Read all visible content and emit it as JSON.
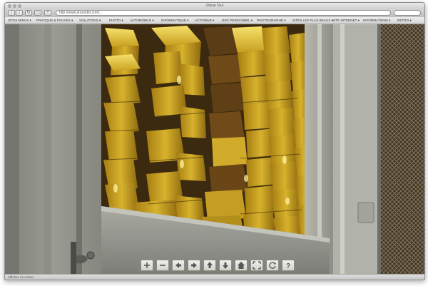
{
  "window": {
    "title": "Virtual Tour"
  },
  "toolbar": {
    "back_icon": "back-arrow-icon",
    "forward_icon": "forward-arrow-icon",
    "reload_icon": "reload-icon",
    "add_icon": "add-tab-icon",
    "url": "http://www.arounder.com/..."
  },
  "menubar": {
    "items": [
      "SITES MINUS ▾",
      "PRATIQUE & POUVES ▾",
      "SOLUTIONS ▾",
      "PHOTO ▾",
      "AUTOMOBILE ▾",
      "INFORMATIQUE ▾",
      "ACTIONNS ▾",
      "DOC PERSONNEL ▾",
      "PHOTOGRAPHIE ▾",
      "SITES LES PLUS BEAUX ▾",
      "SITE INTERNET ▾",
      "INFORMATIONS ▾",
      "RETRO ▾"
    ]
  },
  "statusbar": {
    "text": "Affichez en mémo"
  },
  "viewer": {
    "scene": "Gold bars stacked in vault",
    "controls": [
      {
        "name": "zoom-in-button",
        "icon": "plus-icon"
      },
      {
        "name": "zoom-out-button",
        "icon": "minus-icon"
      },
      {
        "name": "pan-left-button",
        "icon": "arrow-left-icon"
      },
      {
        "name": "pan-right-button",
        "icon": "arrow-right-icon"
      },
      {
        "name": "pan-up-button",
        "icon": "arrow-up-icon"
      },
      {
        "name": "pan-down-button",
        "icon": "arrow-down-icon"
      },
      {
        "name": "home-button",
        "icon": "home-icon"
      },
      {
        "name": "fullscreen-button",
        "icon": "fullscreen-icon"
      },
      {
        "name": "autorotate-button",
        "icon": "rotate-icon"
      },
      {
        "name": "help-button",
        "icon": "help-icon"
      }
    ]
  },
  "colors": {
    "gold": "#c9a51c",
    "gold_highlight": "#f3dc5a",
    "gold_shadow": "#6b5010",
    "wall": "#8c8e86",
    "mesh": "#5c5040"
  }
}
